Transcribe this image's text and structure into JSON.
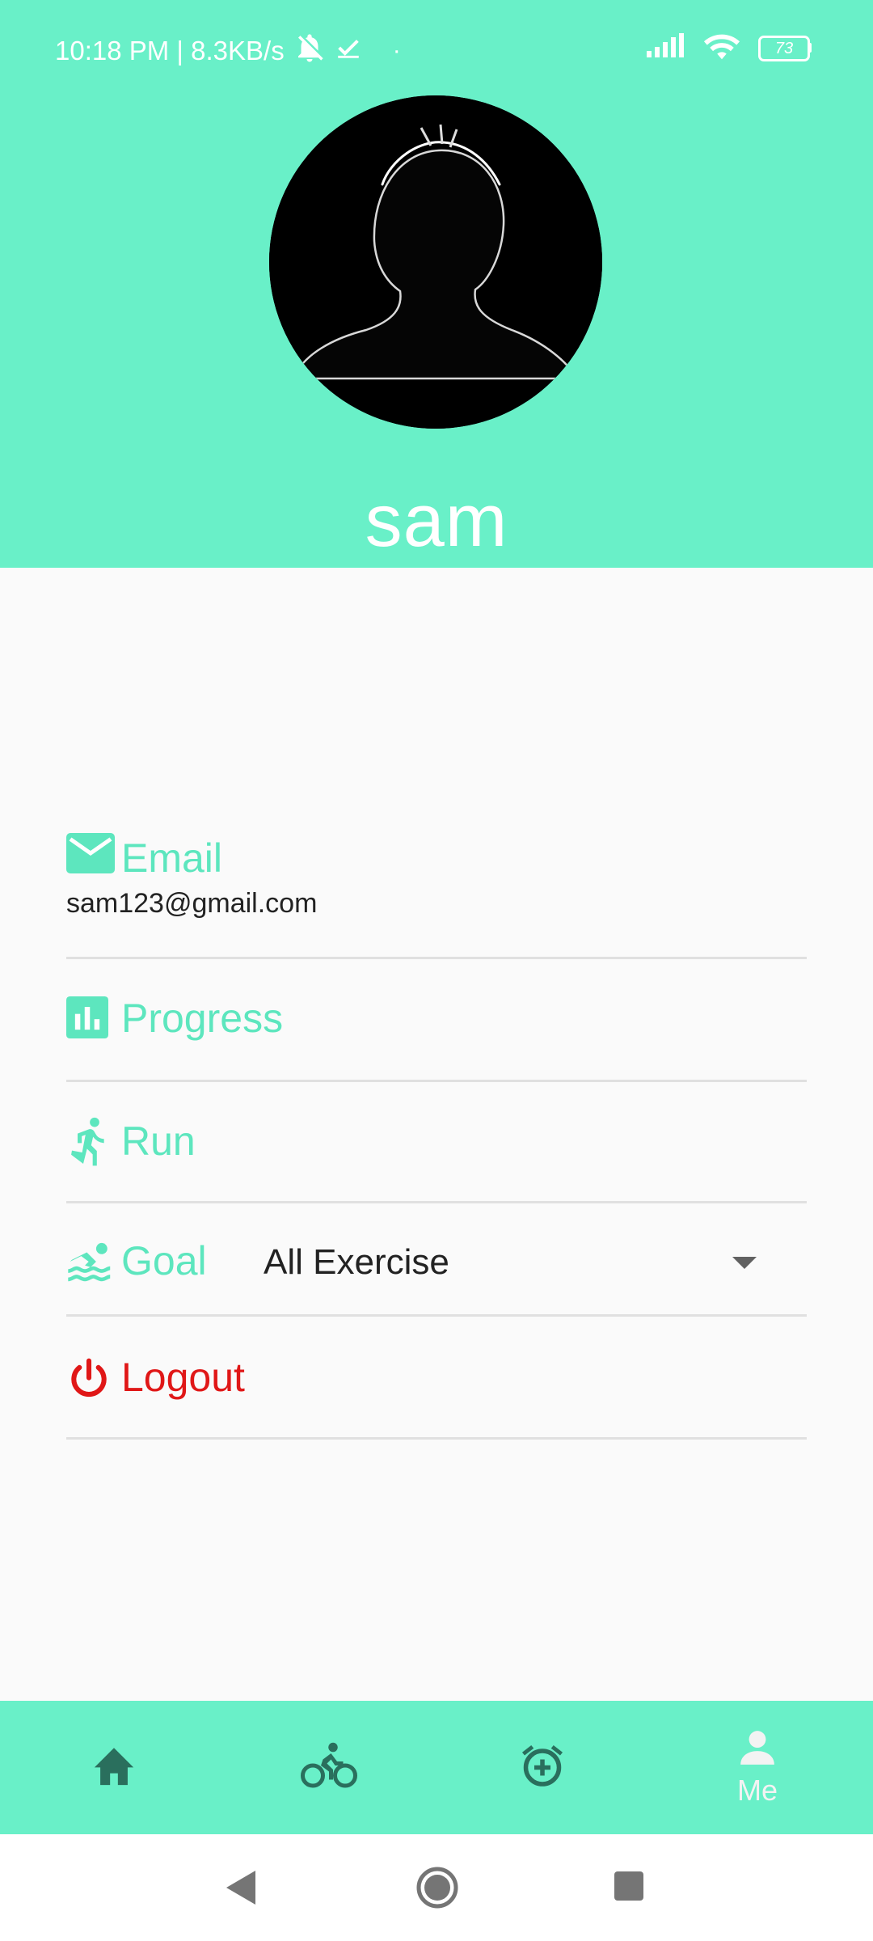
{
  "status_bar": {
    "time_speed": "10:18 PM | 8.3KB/s",
    "battery": "73"
  },
  "profile": {
    "name": "sam"
  },
  "items": {
    "email": {
      "label": "Email",
      "value": "sam123@gmail.com"
    },
    "progress": {
      "label": "Progress"
    },
    "run": {
      "label": "Run"
    },
    "goal": {
      "label": "Goal",
      "selected": "All Exercise"
    },
    "logout": {
      "label": "Logout"
    }
  },
  "bottom_nav": {
    "items": [
      {
        "icon": "home-icon"
      },
      {
        "icon": "bike-icon"
      },
      {
        "icon": "alarm-add-icon"
      },
      {
        "icon": "person-icon",
        "label": "Me"
      }
    ]
  },
  "colors": {
    "accent": "#69f0c8",
    "label": "#5de6be",
    "logout": "#e01717",
    "nav_icon": "#2a6f5d"
  },
  "system_nav": {
    "buttons": [
      "back-icon",
      "home-circle-icon",
      "recents-icon"
    ]
  }
}
